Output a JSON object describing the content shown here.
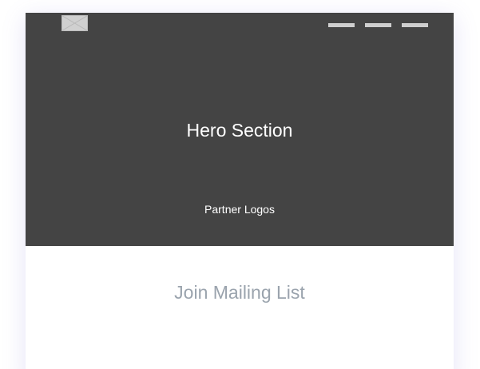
{
  "header": {
    "logo_icon": "image-placeholder-icon",
    "nav_items": [
      "",
      "",
      ""
    ]
  },
  "hero": {
    "title": "Hero Section",
    "partner_logos": "Partner Logos"
  },
  "mailing": {
    "title": "Join Mailing List"
  },
  "colors": {
    "hero_bg": "#444444",
    "nav_placeholder": "#cfcfcf",
    "mailing_text": "#9aa3ad"
  }
}
